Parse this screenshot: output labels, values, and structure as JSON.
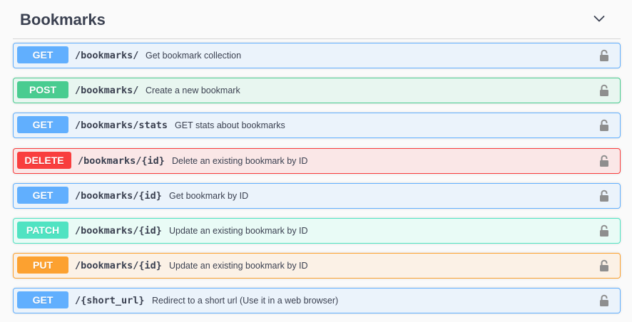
{
  "section": {
    "title": "Bookmarks"
  },
  "operations": [
    {
      "method": "GET",
      "path": "/bookmarks/",
      "description": "Get bookmark collection"
    },
    {
      "method": "POST",
      "path": "/bookmarks/",
      "description": "Create a new bookmark"
    },
    {
      "method": "GET",
      "path": "/bookmarks/stats",
      "description": "GET stats about bookmarks"
    },
    {
      "method": "DELETE",
      "path": "/bookmarks/{id}",
      "description": "Delete an existing bookmark by ID"
    },
    {
      "method": "GET",
      "path": "/bookmarks/{id}",
      "description": "Get bookmark by ID"
    },
    {
      "method": "PATCH",
      "path": "/bookmarks/{id}",
      "description": "Update an existing bookmark by ID"
    },
    {
      "method": "PUT",
      "path": "/bookmarks/{id}",
      "description": "Update an existing bookmark by ID"
    },
    {
      "method": "GET",
      "path": "/{short_url}",
      "description": "Redirect to a short url (Use it in a web browser)"
    }
  ],
  "colors": {
    "GET": {
      "badge": "#61affe",
      "border": "#61affe",
      "bg": "#ebf3fb"
    },
    "POST": {
      "badge": "#49cc90",
      "border": "#49cc90",
      "bg": "#e8f6f0"
    },
    "DELETE": {
      "badge": "#f93e3e",
      "border": "#f93e3e",
      "bg": "#fae7e7"
    },
    "PATCH": {
      "badge": "#50e3c2",
      "border": "#50e3c2",
      "bg": "#e9fbf6"
    },
    "PUT": {
      "badge": "#fca130",
      "border": "#fca130",
      "bg": "#fbf1e6"
    },
    "text": "#3b4151",
    "lock": "#8e8e8e"
  },
  "icons": {
    "collapse": "chevron-down-icon",
    "auth": "lock-icon"
  }
}
